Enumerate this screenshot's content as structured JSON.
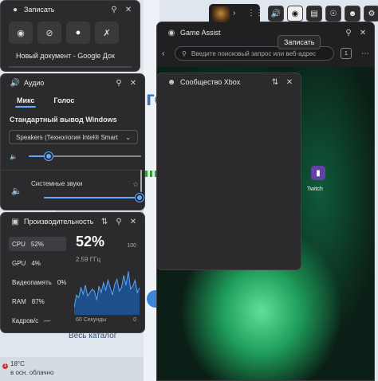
{
  "background": {
    "blue_text": "го",
    "catalog_link": "Весь каталог",
    "weather": {
      "badge": "1",
      "temp": "18°C",
      "desc": "в осн. облачно"
    }
  },
  "gamebar": {
    "widgets": [
      "volume-icon",
      "camera-icon",
      "monitor-icon",
      "xbox-icon",
      "social-icon",
      "settings-icon"
    ],
    "tooltip": "Записать"
  },
  "capture": {
    "title": "Записать",
    "target": "Новый документ - Google Док"
  },
  "audio": {
    "title": "Аудио",
    "tabs": [
      "Микс",
      "Голос"
    ],
    "section": "Стандартный вывод Windows",
    "device": "Speakers (Технология Intel® Smart",
    "master_volume": 0.18,
    "system_sounds_label": "Системные звуки",
    "system_volume": 1.0
  },
  "perf": {
    "title": "Производительность",
    "rows": [
      {
        "name": "CPU",
        "value": "52%"
      },
      {
        "name": "GPU",
        "value": "4%"
      },
      {
        "name": "Видеопамять",
        "value": "0%"
      },
      {
        "name": "RAM",
        "value": "87%"
      },
      {
        "name": "Кадров/с",
        "value": "—"
      }
    ],
    "big_value": "52%",
    "freq": "2.59 ГГц",
    "max_label": "100",
    "min_label": "0",
    "time_label": "60 Секунды",
    "graph": [
      15,
      40,
      35,
      55,
      42,
      60,
      38,
      45,
      52,
      48,
      30,
      58,
      45,
      65,
      50,
      70,
      55,
      40,
      62,
      72,
      48,
      55,
      80,
      60,
      88,
      52,
      58,
      70,
      45,
      55
    ]
  },
  "assist": {
    "title": "Game Assist",
    "search_placeholder": "Введите поисковый запрос или веб-адрес",
    "tab_count": "1",
    "twitch_label": "Twitch"
  },
  "social": {
    "title": "Сообщество Xbox"
  }
}
